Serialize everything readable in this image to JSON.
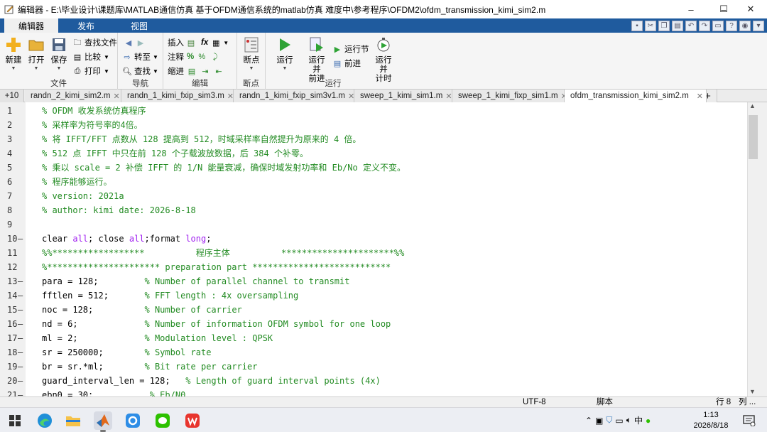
{
  "window": {
    "title": "编辑器 - E:\\毕业设计\\课题库\\MATLAB通信仿真 基于OFDM通信系统的matlab仿真 难度中\\参考程序\\OFDM2\\ofdm_transmission_kimi_sim2.m",
    "minimize": "–",
    "maximize": "☐",
    "close": "✕"
  },
  "ribbon_tabs": [
    "编辑器",
    "发布",
    "视图"
  ],
  "ribbon": {
    "file": {
      "label": "文件",
      "new": "新建",
      "open": "打开",
      "save": "保存",
      "find_files": "查找文件",
      "compare": "比较",
      "print": "打印"
    },
    "navigate": {
      "label": "导航",
      "goto": "转至",
      "find": "查找"
    },
    "edit": {
      "label": "编辑",
      "insert": "插入",
      "fx": "fx",
      "comment": "注释",
      "comment_symbol": "%",
      "indent": "缩进"
    },
    "breakpoints": {
      "label": "断点",
      "button": "断点"
    },
    "run": {
      "label": "运行",
      "run": "运行",
      "run_advance": "运行并\n前进",
      "run_section": "运行节",
      "advance": "前进",
      "run_and_time": "运行并\n计时"
    }
  },
  "doc_tabs": {
    "plus10": "+10",
    "tabs": [
      "randn_2_kimi_sim2.m",
      "randn_1_kimi_fxip_sim3.m",
      "randn_1_kimi_fxip_sim3v1.m",
      "sweep_1_kimi_sim1.m",
      "sweep_1_kimi_fixp_sim1.m",
      "ofdm_transmission_kimi_sim2.m"
    ],
    "active_index": 5,
    "add": "+"
  },
  "code_lines": [
    {
      "n": "1",
      "dash": false,
      "parts": [
        {
          "t": "% OFDM 收发系统仿真程序",
          "c": "cm"
        }
      ]
    },
    {
      "n": "2",
      "dash": false,
      "parts": [
        {
          "t": "% 采样率为符号率的4倍。",
          "c": "cm"
        }
      ]
    },
    {
      "n": "3",
      "dash": false,
      "parts": [
        {
          "t": "% 将 IFFT/FFT 点数从 128 提高到 512，时域采样率自然提升为原来的 4 倍。",
          "c": "cm"
        }
      ]
    },
    {
      "n": "4",
      "dash": false,
      "parts": [
        {
          "t": "% 512 点 IFFT 中只在前 128 个子载波放数据，后 384 个补零。",
          "c": "cm"
        }
      ]
    },
    {
      "n": "5",
      "dash": false,
      "parts": [
        {
          "t": "% 乘以 scale = 2 补偿 IFFT 的 1/N 能量衰减，确保时域发射功率和 Eb/No 定义不变。",
          "c": "cm"
        }
      ]
    },
    {
      "n": "6",
      "dash": false,
      "parts": [
        {
          "t": "% 程序能够运行。",
          "c": "cm"
        }
      ]
    },
    {
      "n": "7",
      "dash": false,
      "parts": [
        {
          "t": "% version: 2021a",
          "c": "cm"
        }
      ]
    },
    {
      "n": "8",
      "dash": false,
      "parts": [
        {
          "t": "% author: kimi date: 2026-8-18",
          "c": "cm"
        }
      ]
    },
    {
      "n": "9",
      "dash": false,
      "parts": []
    },
    {
      "n": "10",
      "dash": true,
      "parts": [
        {
          "t": "clear ",
          "c": ""
        },
        {
          "t": "all",
          "c": "kw"
        },
        {
          "t": "; close ",
          "c": ""
        },
        {
          "t": "all",
          "c": "kw"
        },
        {
          "t": ";format ",
          "c": ""
        },
        {
          "t": "long",
          "c": "kw"
        },
        {
          "t": ";",
          "c": ""
        }
      ]
    },
    {
      "n": "11",
      "dash": false,
      "parts": [
        {
          "t": "%%******************          程序主体          **********************%%",
          "c": "cm"
        }
      ]
    },
    {
      "n": "12",
      "dash": false,
      "parts": [
        {
          "t": "%********************** preparation part ***************************",
          "c": "cm"
        }
      ]
    },
    {
      "n": "13",
      "dash": true,
      "parts": [
        {
          "t": "para = 128;         ",
          "c": ""
        },
        {
          "t": "% Number of parallel channel to transmit",
          "c": "cm"
        }
      ]
    },
    {
      "n": "14",
      "dash": true,
      "parts": [
        {
          "t": "fftlen = 512;       ",
          "c": ""
        },
        {
          "t": "% FFT length : 4x oversampling",
          "c": "cm"
        }
      ]
    },
    {
      "n": "15",
      "dash": true,
      "parts": [
        {
          "t": "noc = 128;          ",
          "c": ""
        },
        {
          "t": "% Number of carrier",
          "c": "cm"
        }
      ]
    },
    {
      "n": "16",
      "dash": true,
      "parts": [
        {
          "t": "nd = 6;             ",
          "c": ""
        },
        {
          "t": "% Number of information OFDM symbol for one loop",
          "c": "cm"
        }
      ]
    },
    {
      "n": "17",
      "dash": true,
      "parts": [
        {
          "t": "ml = 2;             ",
          "c": ""
        },
        {
          "t": "% Modulation level : QPSK",
          "c": "cm"
        }
      ]
    },
    {
      "n": "18",
      "dash": true,
      "parts": [
        {
          "t": "sr = 250000;        ",
          "c": ""
        },
        {
          "t": "% Symbol rate",
          "c": "cm"
        }
      ]
    },
    {
      "n": "19",
      "dash": true,
      "parts": [
        {
          "t": "br = sr.*ml;        ",
          "c": ""
        },
        {
          "t": "% Bit rate per carrier",
          "c": "cm"
        }
      ]
    },
    {
      "n": "20",
      "dash": true,
      "parts": [
        {
          "t": "guard_interval_len = 128;   ",
          "c": ""
        },
        {
          "t": "% Length of guard interval points (4x)",
          "c": "cm"
        }
      ]
    },
    {
      "n": "21",
      "dash": true,
      "parts": [
        {
          "t": "ebn0 = 30;           ",
          "c": ""
        },
        {
          "t": "% Eb/N0",
          "c": "cm"
        }
      ]
    }
  ],
  "status": {
    "encoding": "UTF-8",
    "type": "脚本",
    "line": "行 8",
    "col": "列 ..."
  },
  "taskbar": {
    "apps": [
      "windows-start",
      "edge",
      "file-explorer",
      "matlab",
      "app-blue",
      "wechat",
      "wps"
    ],
    "tray_ime": "中",
    "time": "1:13",
    "date": "2026/8/18"
  },
  "colors": {
    "ribbon_tab_bg": "#1f5b9e",
    "comment": "#228b22",
    "keyword": "#a020f0"
  }
}
